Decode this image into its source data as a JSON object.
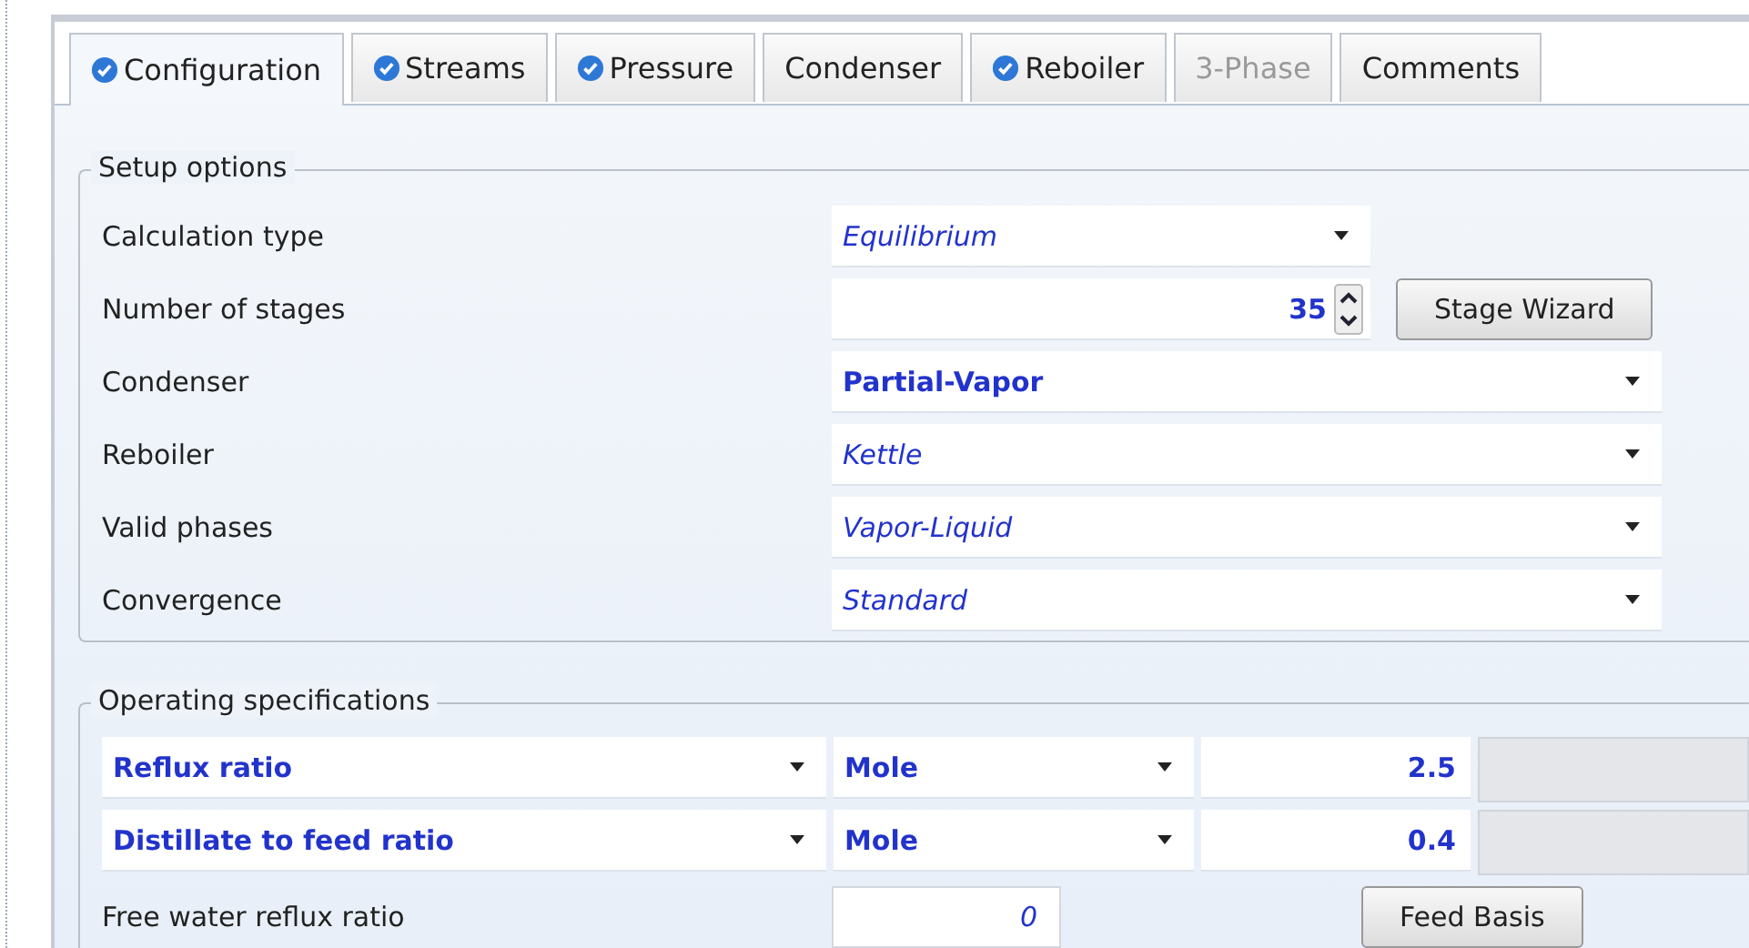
{
  "tabs": [
    {
      "label": "Configuration",
      "selected": true,
      "checked": true,
      "disabled": false
    },
    {
      "label": "Streams",
      "selected": false,
      "checked": true,
      "disabled": false
    },
    {
      "label": "Pressure",
      "selected": false,
      "checked": true,
      "disabled": false
    },
    {
      "label": "Condenser",
      "selected": false,
      "checked": false,
      "disabled": false
    },
    {
      "label": "Reboiler",
      "selected": false,
      "checked": true,
      "disabled": false
    },
    {
      "label": "3-Phase",
      "selected": false,
      "checked": false,
      "disabled": true
    },
    {
      "label": "Comments",
      "selected": false,
      "checked": false,
      "disabled": false
    }
  ],
  "setup_options": {
    "title": "Setup options",
    "rows": [
      {
        "kind": "short_dropdown",
        "label": "Calculation type",
        "value": "Equilibrium",
        "entered": false
      },
      {
        "kind": "spinner",
        "label": "Number of stages",
        "value": "35",
        "entered": true,
        "button": "Stage Wizard"
      },
      {
        "kind": "dropdown",
        "label": "Condenser",
        "value": "Partial-Vapor",
        "entered": true
      },
      {
        "kind": "dropdown",
        "label": "Reboiler",
        "value": "Kettle",
        "entered": false
      },
      {
        "kind": "dropdown",
        "label": "Valid phases",
        "value": "Vapor-Liquid",
        "entered": false
      },
      {
        "kind": "dropdown",
        "label": "Convergence",
        "value": "Standard",
        "entered": false
      }
    ]
  },
  "operating_specifications": {
    "title": "Operating specifications",
    "rows": [
      {
        "spec": "Reflux ratio",
        "basis": "Mole",
        "value": "2.5"
      },
      {
        "spec": "Distillate to feed ratio",
        "basis": "Mole",
        "value": "0.4"
      }
    ],
    "free_water": {
      "label": "Free water reflux ratio",
      "value": "0",
      "entered": false
    },
    "button": "Feed Basis"
  }
}
